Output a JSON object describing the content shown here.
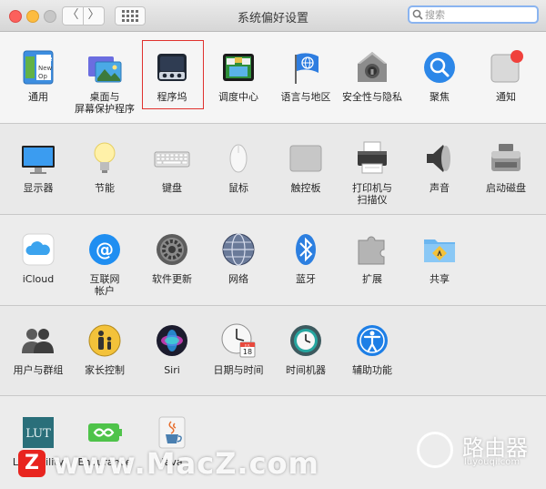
{
  "window": {
    "title": "系统偏好设置"
  },
  "toolbar": {
    "back_glyph": "〈",
    "forward_glyph": "〉",
    "show_all_icon": "grid-icon"
  },
  "search": {
    "placeholder": "搜索"
  },
  "rows": [
    {
      "items": [
        {
          "label": "通用",
          "icon": "general-icon"
        },
        {
          "label": "桌面与\n屏幕保护程序",
          "icon": "desktop-screensaver-icon"
        },
        {
          "label": "程序坞",
          "icon": "dock-icon",
          "selected": true
        },
        {
          "label": "调度中心",
          "icon": "mission-control-icon"
        },
        {
          "label": "语言与地区",
          "icon": "language-region-icon"
        },
        {
          "label": "安全性与隐私",
          "icon": "security-privacy-icon"
        },
        {
          "label": "聚焦",
          "icon": "spotlight-icon"
        },
        {
          "label": "通知",
          "icon": "notifications-icon"
        }
      ]
    },
    {
      "items": [
        {
          "label": "显示器",
          "icon": "displays-icon"
        },
        {
          "label": "节能",
          "icon": "energy-saver-icon"
        },
        {
          "label": "键盘",
          "icon": "keyboard-icon"
        },
        {
          "label": "鼠标",
          "icon": "mouse-icon"
        },
        {
          "label": "触控板",
          "icon": "trackpad-icon"
        },
        {
          "label": "打印机与\n扫描仪",
          "icon": "printer-icon"
        },
        {
          "label": "声音",
          "icon": "sound-icon"
        },
        {
          "label": "启动磁盘",
          "icon": "startup-disk-icon"
        }
      ]
    },
    {
      "items": [
        {
          "label": "iCloud",
          "icon": "icloud-icon"
        },
        {
          "label": "互联网\n帐户",
          "icon": "internet-accounts-icon"
        },
        {
          "label": "软件更新",
          "icon": "software-update-icon"
        },
        {
          "label": "网络",
          "icon": "network-icon"
        },
        {
          "label": "蓝牙",
          "icon": "bluetooth-icon"
        },
        {
          "label": "扩展",
          "icon": "extensions-icon"
        },
        {
          "label": "共享",
          "icon": "sharing-icon"
        }
      ]
    },
    {
      "items": [
        {
          "label": "用户与群组",
          "icon": "users-groups-icon"
        },
        {
          "label": "家长控制",
          "icon": "parental-controls-icon"
        },
        {
          "label": "Siri",
          "icon": "siri-icon"
        },
        {
          "label": "日期与时间",
          "icon": "date-time-icon"
        },
        {
          "label": "时间机器",
          "icon": "time-machine-icon"
        },
        {
          "label": "辅助功能",
          "icon": "accessibility-icon"
        }
      ]
    },
    {
      "items": [
        {
          "label": "LUT Utility",
          "icon": "lut-utility-icon"
        },
        {
          "label": "Endurance",
          "icon": "endurance-icon"
        },
        {
          "label": "Java",
          "icon": "java-icon"
        }
      ]
    }
  ],
  "icon_text": {
    "general_file": "File",
    "general_new": "New",
    "general_op": "Op",
    "lut": "LUT",
    "calendar_month": "JUL",
    "calendar_day": "18"
  },
  "watermarks": {
    "macz_logo": "Z",
    "macz_text": "www.MacZ.com",
    "luyouqi_big": "路由器",
    "luyouqi_small": "luyouqi.com"
  },
  "colors": {
    "selection_border": "#e0312d",
    "search_focus": "#8ab4f0"
  }
}
